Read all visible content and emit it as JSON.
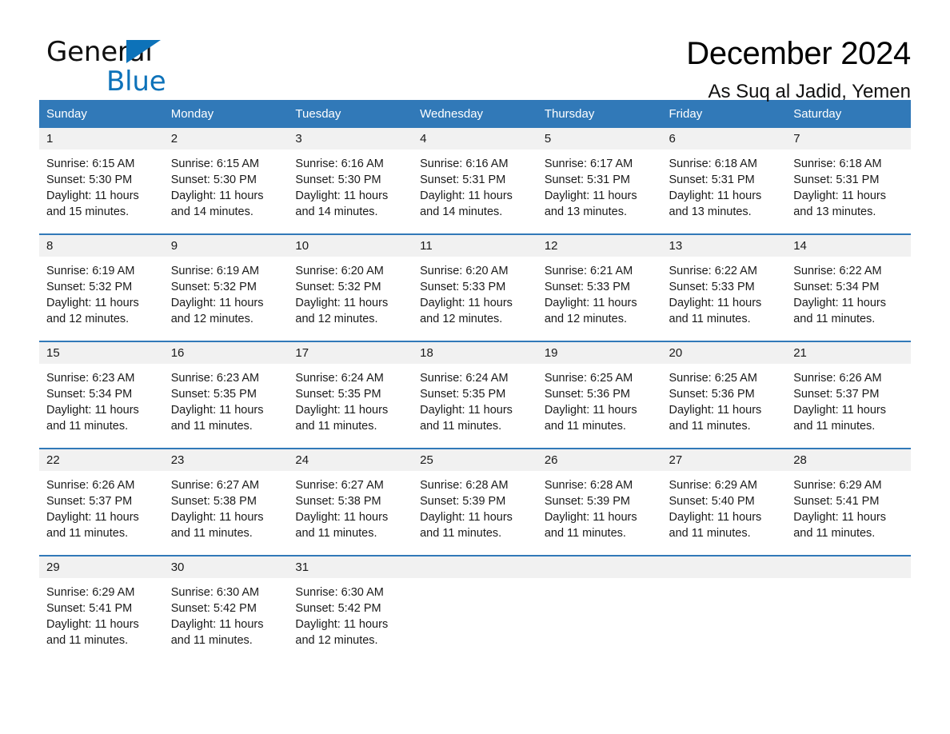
{
  "brand": {
    "line1": "General",
    "line2": "Blue",
    "triangle_color": "#0d72b9"
  },
  "header": {
    "title": "December 2024",
    "subtitle": "As Suq al Jadid, Yemen"
  },
  "theme": {
    "header_blue": "#3179b8",
    "row_divider_blue": "#3179b8",
    "daynum_band": "#f1f1f1"
  },
  "weekdays": [
    "Sunday",
    "Monday",
    "Tuesday",
    "Wednesday",
    "Thursday",
    "Friday",
    "Saturday"
  ],
  "weeks": [
    [
      {
        "day": "1",
        "sunrise": "Sunrise: 6:15 AM",
        "sunset": "Sunset: 5:30 PM",
        "daylight1": "Daylight: 11 hours",
        "daylight2": "and 15 minutes."
      },
      {
        "day": "2",
        "sunrise": "Sunrise: 6:15 AM",
        "sunset": "Sunset: 5:30 PM",
        "daylight1": "Daylight: 11 hours",
        "daylight2": "and 14 minutes."
      },
      {
        "day": "3",
        "sunrise": "Sunrise: 6:16 AM",
        "sunset": "Sunset: 5:30 PM",
        "daylight1": "Daylight: 11 hours",
        "daylight2": "and 14 minutes."
      },
      {
        "day": "4",
        "sunrise": "Sunrise: 6:16 AM",
        "sunset": "Sunset: 5:31 PM",
        "daylight1": "Daylight: 11 hours",
        "daylight2": "and 14 minutes."
      },
      {
        "day": "5",
        "sunrise": "Sunrise: 6:17 AM",
        "sunset": "Sunset: 5:31 PM",
        "daylight1": "Daylight: 11 hours",
        "daylight2": "and 13 minutes."
      },
      {
        "day": "6",
        "sunrise": "Sunrise: 6:18 AM",
        "sunset": "Sunset: 5:31 PM",
        "daylight1": "Daylight: 11 hours",
        "daylight2": "and 13 minutes."
      },
      {
        "day": "7",
        "sunrise": "Sunrise: 6:18 AM",
        "sunset": "Sunset: 5:31 PM",
        "daylight1": "Daylight: 11 hours",
        "daylight2": "and 13 minutes."
      }
    ],
    [
      {
        "day": "8",
        "sunrise": "Sunrise: 6:19 AM",
        "sunset": "Sunset: 5:32 PM",
        "daylight1": "Daylight: 11 hours",
        "daylight2": "and 12 minutes."
      },
      {
        "day": "9",
        "sunrise": "Sunrise: 6:19 AM",
        "sunset": "Sunset: 5:32 PM",
        "daylight1": "Daylight: 11 hours",
        "daylight2": "and 12 minutes."
      },
      {
        "day": "10",
        "sunrise": "Sunrise: 6:20 AM",
        "sunset": "Sunset: 5:32 PM",
        "daylight1": "Daylight: 11 hours",
        "daylight2": "and 12 minutes."
      },
      {
        "day": "11",
        "sunrise": "Sunrise: 6:20 AM",
        "sunset": "Sunset: 5:33 PM",
        "daylight1": "Daylight: 11 hours",
        "daylight2": "and 12 minutes."
      },
      {
        "day": "12",
        "sunrise": "Sunrise: 6:21 AM",
        "sunset": "Sunset: 5:33 PM",
        "daylight1": "Daylight: 11 hours",
        "daylight2": "and 12 minutes."
      },
      {
        "day": "13",
        "sunrise": "Sunrise: 6:22 AM",
        "sunset": "Sunset: 5:33 PM",
        "daylight1": "Daylight: 11 hours",
        "daylight2": "and 11 minutes."
      },
      {
        "day": "14",
        "sunrise": "Sunrise: 6:22 AM",
        "sunset": "Sunset: 5:34 PM",
        "daylight1": "Daylight: 11 hours",
        "daylight2": "and 11 minutes."
      }
    ],
    [
      {
        "day": "15",
        "sunrise": "Sunrise: 6:23 AM",
        "sunset": "Sunset: 5:34 PM",
        "daylight1": "Daylight: 11 hours",
        "daylight2": "and 11 minutes."
      },
      {
        "day": "16",
        "sunrise": "Sunrise: 6:23 AM",
        "sunset": "Sunset: 5:35 PM",
        "daylight1": "Daylight: 11 hours",
        "daylight2": "and 11 minutes."
      },
      {
        "day": "17",
        "sunrise": "Sunrise: 6:24 AM",
        "sunset": "Sunset: 5:35 PM",
        "daylight1": "Daylight: 11 hours",
        "daylight2": "and 11 minutes."
      },
      {
        "day": "18",
        "sunrise": "Sunrise: 6:24 AM",
        "sunset": "Sunset: 5:35 PM",
        "daylight1": "Daylight: 11 hours",
        "daylight2": "and 11 minutes."
      },
      {
        "day": "19",
        "sunrise": "Sunrise: 6:25 AM",
        "sunset": "Sunset: 5:36 PM",
        "daylight1": "Daylight: 11 hours",
        "daylight2": "and 11 minutes."
      },
      {
        "day": "20",
        "sunrise": "Sunrise: 6:25 AM",
        "sunset": "Sunset: 5:36 PM",
        "daylight1": "Daylight: 11 hours",
        "daylight2": "and 11 minutes."
      },
      {
        "day": "21",
        "sunrise": "Sunrise: 6:26 AM",
        "sunset": "Sunset: 5:37 PM",
        "daylight1": "Daylight: 11 hours",
        "daylight2": "and 11 minutes."
      }
    ],
    [
      {
        "day": "22",
        "sunrise": "Sunrise: 6:26 AM",
        "sunset": "Sunset: 5:37 PM",
        "daylight1": "Daylight: 11 hours",
        "daylight2": "and 11 minutes."
      },
      {
        "day": "23",
        "sunrise": "Sunrise: 6:27 AM",
        "sunset": "Sunset: 5:38 PM",
        "daylight1": "Daylight: 11 hours",
        "daylight2": "and 11 minutes."
      },
      {
        "day": "24",
        "sunrise": "Sunrise: 6:27 AM",
        "sunset": "Sunset: 5:38 PM",
        "daylight1": "Daylight: 11 hours",
        "daylight2": "and 11 minutes."
      },
      {
        "day": "25",
        "sunrise": "Sunrise: 6:28 AM",
        "sunset": "Sunset: 5:39 PM",
        "daylight1": "Daylight: 11 hours",
        "daylight2": "and 11 minutes."
      },
      {
        "day": "26",
        "sunrise": "Sunrise: 6:28 AM",
        "sunset": "Sunset: 5:39 PM",
        "daylight1": "Daylight: 11 hours",
        "daylight2": "and 11 minutes."
      },
      {
        "day": "27",
        "sunrise": "Sunrise: 6:29 AM",
        "sunset": "Sunset: 5:40 PM",
        "daylight1": "Daylight: 11 hours",
        "daylight2": "and 11 minutes."
      },
      {
        "day": "28",
        "sunrise": "Sunrise: 6:29 AM",
        "sunset": "Sunset: 5:41 PM",
        "daylight1": "Daylight: 11 hours",
        "daylight2": "and 11 minutes."
      }
    ],
    [
      {
        "day": "29",
        "sunrise": "Sunrise: 6:29 AM",
        "sunset": "Sunset: 5:41 PM",
        "daylight1": "Daylight: 11 hours",
        "daylight2": "and 11 minutes."
      },
      {
        "day": "30",
        "sunrise": "Sunrise: 6:30 AM",
        "sunset": "Sunset: 5:42 PM",
        "daylight1": "Daylight: 11 hours",
        "daylight2": "and 11 minutes."
      },
      {
        "day": "31",
        "sunrise": "Sunrise: 6:30 AM",
        "sunset": "Sunset: 5:42 PM",
        "daylight1": "Daylight: 11 hours",
        "daylight2": "and 12 minutes."
      },
      {
        "day": "",
        "sunrise": "",
        "sunset": "",
        "daylight1": "",
        "daylight2": ""
      },
      {
        "day": "",
        "sunrise": "",
        "sunset": "",
        "daylight1": "",
        "daylight2": ""
      },
      {
        "day": "",
        "sunrise": "",
        "sunset": "",
        "daylight1": "",
        "daylight2": ""
      },
      {
        "day": "",
        "sunrise": "",
        "sunset": "",
        "daylight1": "",
        "daylight2": ""
      }
    ]
  ]
}
